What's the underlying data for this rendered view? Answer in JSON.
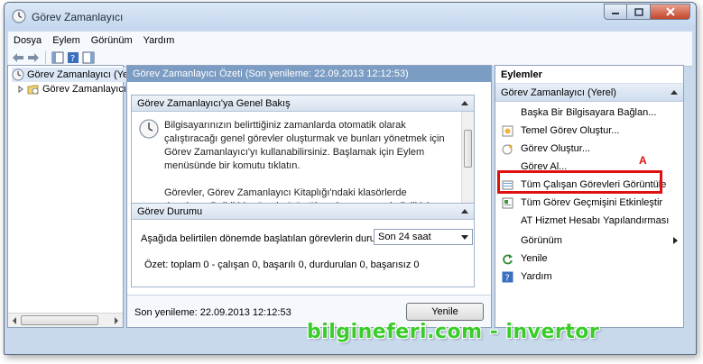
{
  "window": {
    "title": "Görev Zamanlayıcı"
  },
  "menu": [
    "Dosya",
    "Eylem",
    "Görünüm",
    "Yardım"
  ],
  "tree": [
    {
      "label": "Görev Zamanlayıcı (Yer"
    },
    {
      "label": "Görev Zamanlayıcı K"
    }
  ],
  "center": {
    "header": "Görev Zamanlayıcı Özeti (Son yenileme: 22.09.2013 12:12:53)",
    "overview": {
      "title": "Görev Zamanlayıcı'ya Genel Bakış",
      "para1": "Bilgisayarınızın belirttiğiniz zamanlarda otomatik olarak çalıştıracağı genel görevler oluşturmak ve bunları yönetmek için Görev Zamanlayıcı'yı kullanabilirsiniz. Başlamak için Eylem menüsünde bir komutu tıklatın.",
      "para2": "Görevler, Görev Zamanlayıcı Kitaplığı'ndaki klasörlerde depolanır. Belirli bir görevi görüntülemek veya onunla ilgili işlem yapmak için"
    },
    "status": {
      "title": "Görev Durumu",
      "label": "Aşağıda belirtilen dönemde başlatılan görevlerin duru...",
      "select_value": "Son 24 saat",
      "summary": "Özet: toplam 0 - çalışan 0, başarılı 0, durdurulan 0, başarısız 0"
    },
    "footer": {
      "last_refresh": "Son yenileme: 22.09.2013 12:12:53",
      "refresh_button": "Yenile"
    }
  },
  "actions": {
    "title": "Eylemler",
    "group": "Görev Zamanlayıcı (Yerel)",
    "items": [
      {
        "label": "Başka Bir Bilgisayara Bağlan...",
        "icon": "none"
      },
      {
        "label": "Temel Görev Oluştur...",
        "icon": "basic-task-icon"
      },
      {
        "label": "Görev Oluştur...",
        "icon": "create-task-icon"
      },
      {
        "label": "Görev Al...",
        "icon": "none"
      },
      {
        "label": "Tüm Çalışan Görevleri Görüntüle",
        "icon": "running-tasks-icon"
      },
      {
        "label": "Tüm Görev Geçmişini Etkinleştir",
        "icon": "history-icon"
      },
      {
        "label": "AT Hizmet Hesabı Yapılandırması",
        "icon": "none"
      },
      {
        "label": "Görünüm",
        "icon": "none"
      },
      {
        "label": "Yenile",
        "icon": "refresh-icon"
      },
      {
        "label": "Yardım",
        "icon": "help-icon"
      }
    ]
  },
  "annotation": {
    "label": "A",
    "color": "#e01010"
  },
  "watermark": "bilgineferi.com - invertor"
}
